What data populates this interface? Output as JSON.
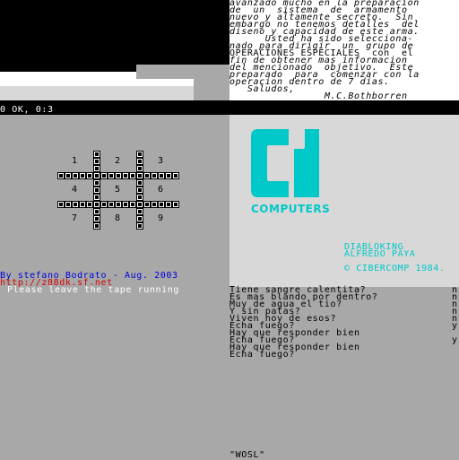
{
  "story_text": [
    "avanzado mucho en la preparacion",
    "de  un  sistema  de  armamento",
    "nuevo y altamente secreto.  Sin",
    "embargo no tenemos detalles  del",
    "diseno y capacidad de este arma.",
    "      Usted ha sido selecciona-",
    "nado para dirigir  un  grupo de",
    "OPERACIONES ESPECIALES  con  el",
    "fin de obtener mas informacion",
    "del mencionado  objetivo.  Este",
    "preparado  para  comenzar con la",
    "operacion dentro de 7 dias.",
    "   Saludos,",
    "                M.C.Bothborren"
  ],
  "status": "0 OK, 0:3",
  "keypad": {
    "numbers": [
      "1",
      "2",
      "3",
      "4",
      "5",
      "6",
      "7",
      "8",
      "9"
    ]
  },
  "credit": "By stefano Bodrato - Aug. 2003",
  "url": "http://z88dk.sf.net",
  "tape_message": "Please leave the tape running",
  "logo": {
    "brand": "COMPUTERS",
    "authors": [
      "DIABLOKING",
      "ALFREDO PAYA"
    ],
    "copyright": "© CIBERCOMP 1984.",
    "color": "#00c8c8"
  },
  "dialog": [
    {
      "q": "Tiene sangre calentita?",
      "a": "n"
    },
    {
      "q": "Es mas blando por dentro?",
      "a": "n"
    },
    {
      "q": "Muy de agua el tio?",
      "a": "n"
    },
    {
      "q": "Y sin patas?",
      "a": "n"
    },
    {
      "q": "Viven hoy de esos?",
      "a": "n"
    },
    {
      "q": "Echa fuego?",
      "a": "y"
    },
    {
      "q": "Hay que responder bien",
      "a": ""
    },
    {
      "q": "Echa fuego?",
      "a": "y"
    },
    {
      "q": "Hay que responder bien",
      "a": ""
    },
    {
      "q": "Echa fuego?",
      "a": ""
    }
  ],
  "input_line": "\"WOSL\""
}
